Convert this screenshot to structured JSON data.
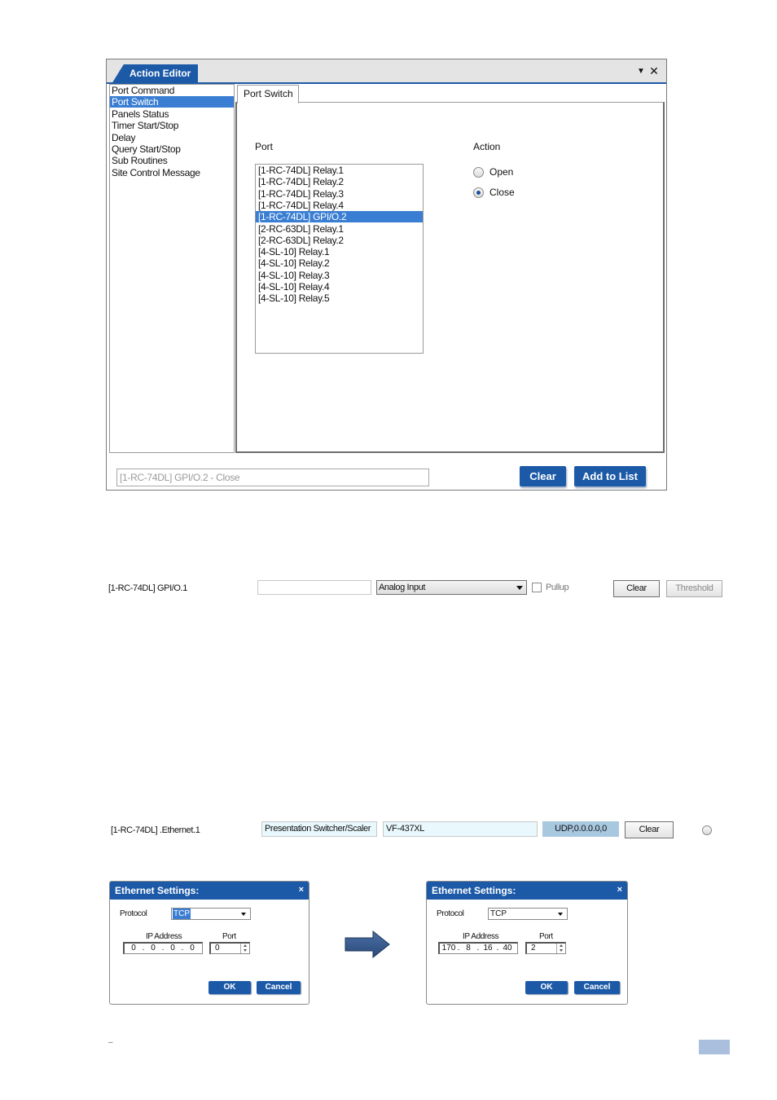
{
  "action_editor": {
    "title": "Action Editor",
    "action_types": [
      "Port Command",
      "Port Switch",
      "Panels Status",
      "Timer Start/Stop",
      "Delay",
      "Query Start/Stop",
      "Sub Routines",
      "Site Control Message"
    ],
    "selected_action_type": "Port Switch",
    "tab_label": "Port Switch",
    "port_label": "Port",
    "action_label": "Action",
    "ports": [
      "[1-RC-74DL] Relay.1",
      "[1-RC-74DL] Relay.2",
      "[1-RC-74DL] Relay.3",
      "[1-RC-74DL] Relay.4",
      "[1-RC-74DL] GPI/O.2",
      "[2-RC-63DL] Relay.1",
      "[2-RC-63DL] Relay.2",
      "[4-SL-10] Relay.1",
      "[4-SL-10] Relay.2",
      "[4-SL-10] Relay.3",
      "[4-SL-10] Relay.4",
      "[4-SL-10] Relay.5"
    ],
    "selected_port": "[1-RC-74DL] GPI/O.2",
    "actions": [
      "Open",
      "Close"
    ],
    "selected_action": "Close",
    "summary": "[1-RC-74DL] GPI/O.2 - Close",
    "clear_label": "Clear",
    "add_to_list_label": "Add to List"
  },
  "gpio_row": {
    "name": "[1-RC-74DL] GPI/O.1",
    "text_value": "",
    "mode": "Analog Input",
    "pullup_label": "Pullup",
    "pullup_checked": false,
    "clear_label": "Clear",
    "threshold_label": "Threshold"
  },
  "ethernet_row": {
    "name": "[1-RC-74DL] .Ethernet.1",
    "device_type": "Presentation Switcher/Scaler",
    "device_model": "VF-437XL",
    "connection": "UDP,0.0.0.0,0",
    "clear_label": "Clear"
  },
  "ethernet_dialogs": [
    {
      "title": "Ethernet Settings:",
      "close_glyph": "×",
      "protocol_label": "Protocol",
      "protocol": "TCP",
      "ip_label": "IP Address",
      "port_label": "Port",
      "ip": [
        "0",
        "0",
        "0",
        "0"
      ],
      "port": "0",
      "ok_label": "OK",
      "cancel_label": "Cancel"
    },
    {
      "title": "Ethernet Settings:",
      "close_glyph": "×",
      "protocol_label": "Protocol",
      "protocol": "TCP",
      "ip_label": "IP Address",
      "port_label": "Port",
      "ip": [
        "170",
        "8",
        "16",
        "40"
      ],
      "port": "2",
      "ok_label": "OK",
      "cancel_label": "Cancel"
    }
  ],
  "footer": {
    "dash": "–"
  },
  "colors": {
    "accent": "#1c5aa8",
    "selection": "#3a7ed3",
    "connection_bg": "#a8c8e0",
    "device_field_bg": "#e8f8fc",
    "page_number_box": "#a9bfdd"
  },
  "icons": {
    "titlebar_menu": "dropdown-arrow-icon",
    "titlebar_close": "close-icon",
    "flow_arrow": "right-arrow-icon"
  }
}
